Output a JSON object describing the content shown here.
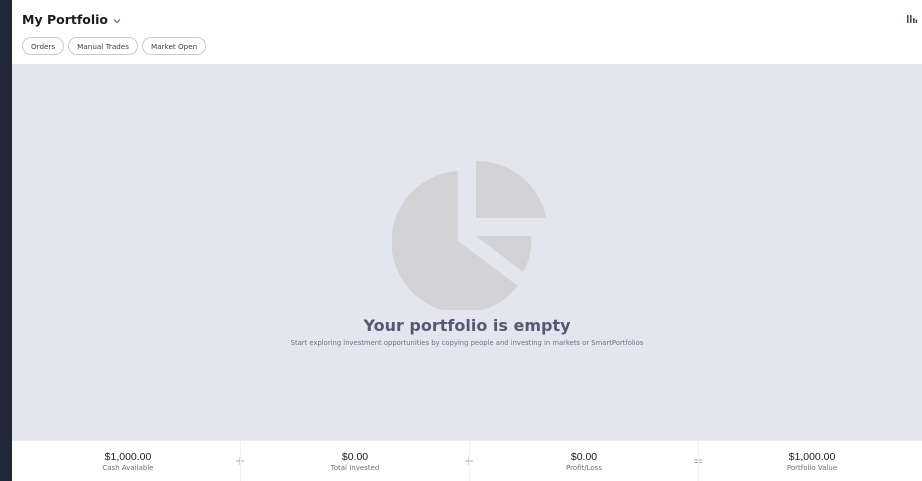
{
  "header": {
    "title": "My Portfolio",
    "title_icon": "chevron-down-icon",
    "layout_icon": "columns-layout-icon",
    "pills": [
      {
        "label": "Orders"
      },
      {
        "label": "Manual Trades"
      },
      {
        "label": "Market Open"
      }
    ]
  },
  "main": {
    "illustration_icon": "pie-chart-icon",
    "empty_title": "Your portfolio is empty",
    "empty_subtitle": "Start exploring investment opportunities by copying people and investing in markets or SmartPortfolios"
  },
  "footer": {
    "stats": [
      {
        "value": "$1,000.00",
        "label": "Cash Available"
      },
      {
        "value": "$0.00",
        "label": "Total Invested"
      },
      {
        "value": "$0.00",
        "label": "Profit/Loss"
      },
      {
        "value": "$1,000.00",
        "label": "Portfolio Value"
      }
    ],
    "operators": [
      "+",
      "+",
      "="
    ]
  },
  "colors": {
    "page_background": "#e3e5ef",
    "header_background": "#ffffff",
    "left_rail": "#232838",
    "pie_fill": "#d3d3d6",
    "empty_title": "#555a70"
  }
}
